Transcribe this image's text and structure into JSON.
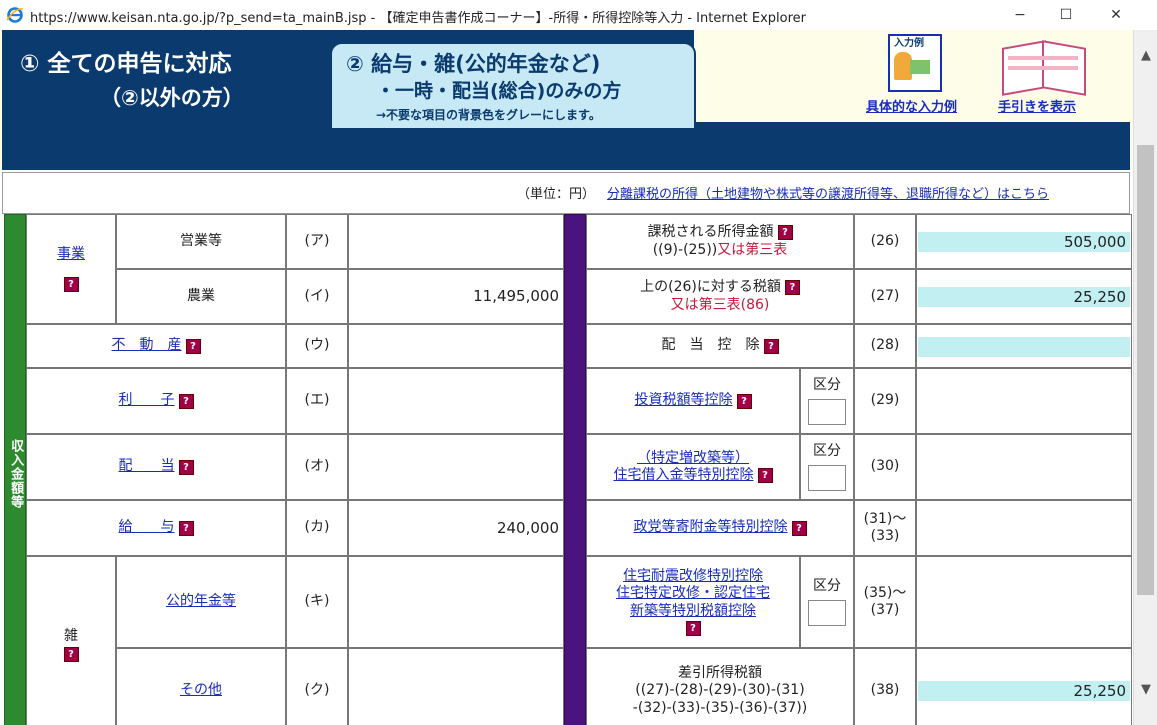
{
  "window": {
    "title": "https://www.keisan.nta.go.jp/?p_send=ta_mainB.jsp - 【確定申告書作成コーナー】-所得・所得控除等入力 - Internet Explorer",
    "minimize": "−",
    "maximize": "☐",
    "close": "✕"
  },
  "banner": {
    "tab1_line1": "① 全ての申告に対応",
    "tab1_line2": "（②以外の方）",
    "tab2_line1": "② 給与・雑(公的年金など)",
    "tab2_line2": "・一時・配当(総合)のみの方",
    "tab2_line3": "→不要な項目の背景色をグレーにします。",
    "help_example_img": "入力例",
    "help_example_label": "具体的な入力例",
    "help_guide_label": "手引きを表示"
  },
  "unit_row": {
    "unit": "（単位：円）",
    "separate_link": "分離課税の所得（土地建物や株式等の譲渡所得等、退職所得など）はこちら"
  },
  "left": {
    "vertical_label": "収入金額等",
    "business": "事業",
    "business_sales": "営業等",
    "business_sales_code": "(ア)",
    "business_sales_value": "",
    "business_farm": "農業",
    "business_farm_code": "(イ)",
    "business_farm_value": "11,495,000",
    "real_estate": "不　動　産",
    "real_estate_code": "(ウ)",
    "interest": "利　　子",
    "interest_code": "(エ)",
    "dividend": "配　　当",
    "dividend_code": "(オ)",
    "salary": "給　　与",
    "salary_code": "(カ)",
    "salary_value": "240,000",
    "misc": "雑",
    "public_pension": "公的年金等",
    "public_pension_code": "(キ)",
    "other": "その他",
    "other_code": "(ク)"
  },
  "right": {
    "r26_label1": "課税される所得金額",
    "r26_label2": "((9)-(25))",
    "r26_label3": "又は第三表",
    "r26_code": "(26)",
    "r26_value": "505,000",
    "r27_label1": "上の(26)に対する税額",
    "r27_label2": "又は第三表(86)",
    "r27_code": "(27)",
    "r27_value": "25,250",
    "r28_label": "配　当　控　除",
    "r28_code": "(28)",
    "r29_label": "投資税額等控除",
    "r29_kubun": "区分",
    "r29_code": "(29)",
    "r30_label1": "（特定増改築等）",
    "r30_label2": "住宅借入金等特別控除",
    "r30_kubun": "区分",
    "r30_code": "(30)",
    "r31_label": "政党等寄附金等特別控除",
    "r31_code1": "(31)～",
    "r31_code2": "(33)",
    "r35_label1": "住宅耐震改修特別控除",
    "r35_label2": "住宅特定改修・認定住宅",
    "r35_label3": "新築等特別税額控除",
    "r35_kubun": "区分",
    "r35_code1": "(35)～",
    "r35_code2": "(37)",
    "r38_label1": "差引所得税額",
    "r38_label2": "((27)-(28)-(29)-(30)-(31)",
    "r38_label3": "-(32)-(33)-(35)-(36)-(37))",
    "r38_code": "(38)",
    "r38_value": "25,250"
  },
  "help_mark": "?",
  "colors": {
    "navy": "#0b3a6e",
    "green": "#2e8a2e",
    "purple": "#4a1380",
    "cyan": "#c2f0f2",
    "link": "#1a2db8"
  }
}
